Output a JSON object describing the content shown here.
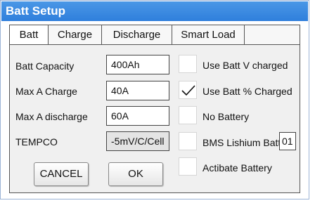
{
  "window": {
    "title": "Batt Setup"
  },
  "tabs": [
    {
      "label": "Batt",
      "active": true
    },
    {
      "label": "Charge",
      "active": false
    },
    {
      "label": "Discharge",
      "active": false
    },
    {
      "label": "Smart Load",
      "active": false
    },
    {
      "label": "",
      "active": false
    }
  ],
  "settings": {
    "capacity": {
      "label": "Batt Capacity",
      "value": "400Ah"
    },
    "max_charge": {
      "label": "Max A Charge",
      "value": "40A"
    },
    "max_discharge": {
      "label": "Max A discharge",
      "value": "60A"
    },
    "tempco": {
      "label": "TEMPCO",
      "value": "-5mV/C/Cell"
    }
  },
  "options": [
    {
      "label": "Use Batt V charged",
      "checked": false
    },
    {
      "label": "Use Batt % Charged",
      "checked": true
    },
    {
      "label": "No Battery",
      "checked": false
    },
    {
      "label": "BMS Lishium Batt",
      "checked": false,
      "value": "01"
    },
    {
      "label": "Actibate Battery",
      "checked": false
    }
  ],
  "buttons": {
    "cancel": "CANCEL",
    "ok": "OK"
  },
  "colors": {
    "titlebar": "#3a8ae2",
    "panel": "#f0f0f0"
  },
  "icons": {
    "checked": "checkmark-icon"
  }
}
